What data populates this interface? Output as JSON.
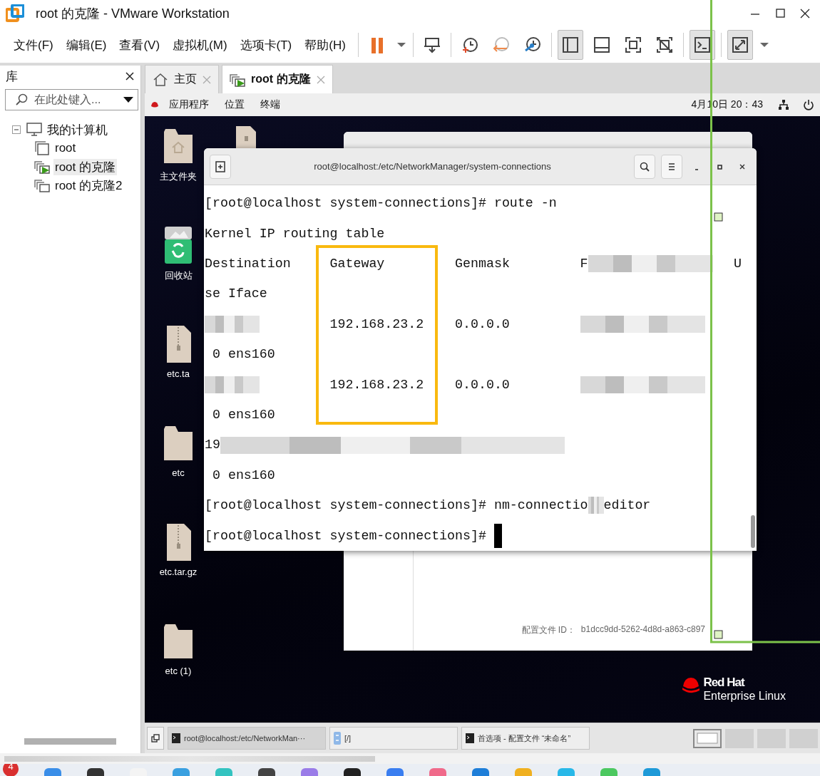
{
  "window": {
    "title": "root 的克隆 - VMware Workstation"
  },
  "menu": [
    "文件(F)",
    "编辑(E)",
    "查看(V)",
    "虚拟机(M)",
    "选项卡(T)",
    "帮助(H)"
  ],
  "toolbar": [
    [
      {
        "kind": "pause",
        "selected": false
      },
      {
        "kind": "caret",
        "selected": false
      }
    ],
    [
      {
        "kind": "send-keys",
        "selected": false
      }
    ],
    [
      {
        "kind": "snapshot",
        "selected": false
      },
      {
        "kind": "revert",
        "selected": false
      },
      {
        "kind": "snapshot-manager",
        "selected": false
      }
    ],
    [
      {
        "kind": "library",
        "selected": true
      },
      {
        "kind": "thumbnails",
        "selected": false
      },
      {
        "kind": "fullscreen",
        "selected": false
      },
      {
        "kind": "unity",
        "selected": false
      }
    ],
    [
      {
        "kind": "console",
        "selected": true
      }
    ],
    [
      {
        "kind": "stretch",
        "selected": true
      },
      {
        "kind": "caret",
        "selected": false
      }
    ]
  ],
  "library": {
    "title": "库",
    "search": {
      "placeholder": "在此处键入..."
    },
    "tree": [
      {
        "label": "我的计算机",
        "kind": "computer",
        "expanded": true,
        "selected": false,
        "children": [
          {
            "label": "root",
            "kind": "vm",
            "selected": false
          },
          {
            "label": "root 的克隆",
            "kind": "vm-running",
            "selected": true
          },
          {
            "label": "root 的克隆2",
            "kind": "clone",
            "selected": false
          }
        ]
      }
    ]
  },
  "tabs": [
    {
      "label": "主页",
      "kind": "home",
      "selected": false
    },
    {
      "label": "root 的克隆",
      "kind": "vm-running",
      "selected": true
    }
  ],
  "guest": {
    "topbar": {
      "menus": [
        "应用程序",
        "位置",
        "终端"
      ],
      "clock": "4月10日 20：43"
    },
    "desktop_icons": [
      {
        "label": "主文件夹",
        "kind": "home-folder"
      },
      {
        "label": "回收站",
        "kind": "trash"
      },
      {
        "label": "etc.ta",
        "kind": "archive"
      },
      {
        "label": "etc",
        "kind": "folder"
      },
      {
        "label": "etc.tar.gz",
        "kind": "archive"
      },
      {
        "label": "etc (1)",
        "kind": "folder"
      }
    ],
    "prefs_window": {
      "footer_label": "配置文件 ID：",
      "profile_id": "b1dcc9dd-5262-4d8d-a863-c897"
    },
    "terminal": {
      "title": "root@localhost:/etc/NetworkManager/system-connections",
      "cursor": true,
      "lines": [
        {
          "segments": [
            {
              "text": "[root@localhost system-connections]# route -n"
            }
          ]
        },
        {
          "segments": [
            {
              "text": "Kernel IP routing table"
            }
          ]
        },
        {
          "segments": [
            {
              "text": "Destination     Gateway         Genmask         F"
            },
            {
              "kind": "blur"
            },
            {
              "text": "U",
              "kind": "tail"
            }
          ]
        },
        {
          "segments": [
            {
              "text": "se Iface"
            }
          ]
        },
        {
          "segments": [
            {
              "kind": "blur"
            },
            {
              "text": "         192.168.23.2    0.0.0.0         "
            },
            {
              "kind": "blur"
            }
          ]
        },
        {
          "segments": [
            {
              "text": " 0 ens160"
            }
          ]
        },
        {
          "segments": [
            {
              "kind": "blur"
            },
            {
              "text": "         192.168.23.2    0.0.0.0         "
            },
            {
              "kind": "blur"
            }
          ]
        },
        {
          "segments": [
            {
              "text": " 0 ens160"
            }
          ]
        },
        {
          "segments": [
            {
              "text": "19"
            },
            {
              "kind": "blur"
            }
          ]
        },
        {
          "segments": [
            {
              "text": " 0 ens160"
            }
          ]
        },
        {
          "segments": [
            {
              "text": "[root@localhost system-connections]# nm-connectio"
            },
            {
              "kind": "blur"
            },
            {
              "text": "editor"
            }
          ]
        },
        {
          "segments": [
            {
              "text": "[root@localhost system-connections]# "
            }
          ]
        }
      ]
    },
    "logo": {
      "line_1": "Red Hat",
      "line_2": "Enterprise Linux"
    },
    "taskbar": {
      "items": [
        {
          "label": "root@localhost:/etc/NetworkMan···",
          "kind": "terminal",
          "selected": true
        },
        {
          "label": "[/]",
          "kind": "files",
          "selected": false
        },
        {
          "label": "首选项 - 配置文件 “未命名”",
          "kind": "terminal",
          "selected": false
        }
      ],
      "workspaces": [
        {
          "selected": true
        },
        {
          "selected": false
        },
        {
          "selected": false
        },
        {
          "selected": false
        }
      ]
    }
  },
  "host_taskbar": {
    "badge": "4"
  }
}
